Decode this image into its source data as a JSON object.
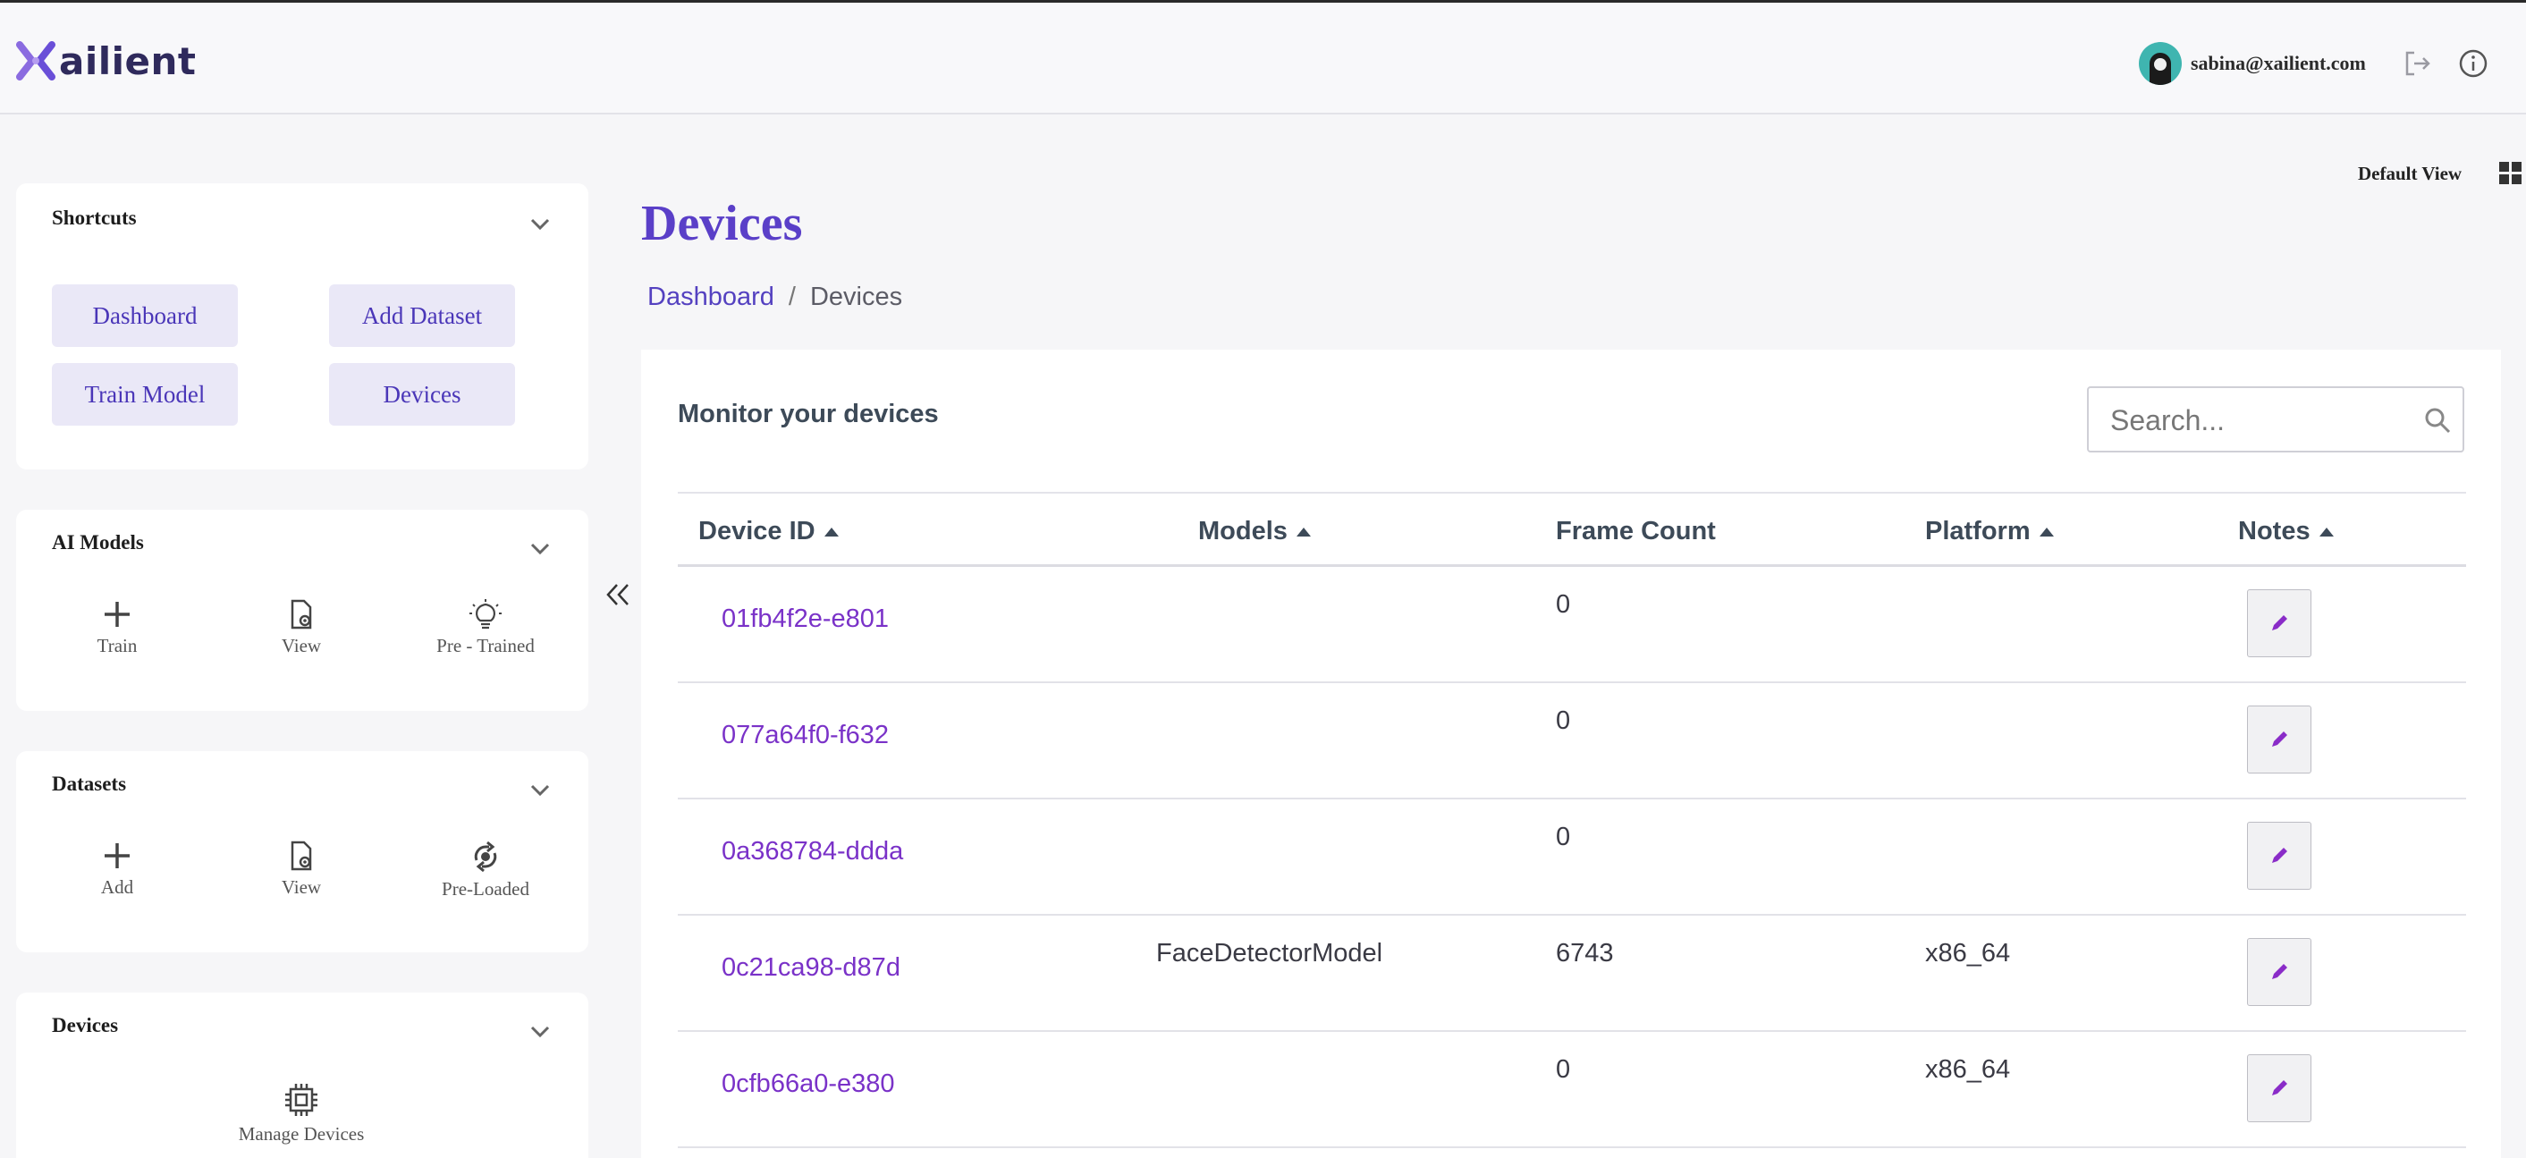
{
  "app": {
    "logo_text": "ailient",
    "user_email": "sabina@xailient.com"
  },
  "sidebar": {
    "shortcuts": {
      "title": "Shortcuts",
      "buttons": [
        "Dashboard",
        "Add Dataset",
        "Train Model",
        "Devices"
      ]
    },
    "ai_models": {
      "title": "AI Models",
      "tools": [
        {
          "label": "Train",
          "icon": "plus-icon"
        },
        {
          "label": "View",
          "icon": "file-view-icon"
        },
        {
          "label": "Pre - Trained",
          "icon": "lightbulb-icon"
        }
      ]
    },
    "datasets": {
      "title": "Datasets",
      "tools": [
        {
          "label": "Add",
          "icon": "plus-icon"
        },
        {
          "label": "View",
          "icon": "file-view-icon"
        },
        {
          "label": "Pre-Loaded",
          "icon": "refresh-icon"
        }
      ]
    },
    "devices": {
      "title": "Devices",
      "tools": [
        {
          "label": "Manage Devices",
          "icon": "chip-icon"
        }
      ]
    }
  },
  "main": {
    "view_label": "Default View",
    "title": "Devices",
    "breadcrumb": [
      "Dashboard",
      "Devices"
    ],
    "panel_title": "Monitor your devices",
    "search_placeholder": "Search...",
    "columns": [
      "Device ID",
      "Models",
      "Frame Count",
      "Platform",
      "Notes"
    ],
    "rows": [
      {
        "device_id": "01fb4f2e-e801",
        "models": "",
        "frame_count": "0",
        "platform": ""
      },
      {
        "device_id": "077a64f0-f632",
        "models": "",
        "frame_count": "0",
        "platform": ""
      },
      {
        "device_id": "0a368784-ddda",
        "models": "",
        "frame_count": "0",
        "platform": ""
      },
      {
        "device_id": "0c21ca98-d87d",
        "models": "FaceDetectorModel",
        "frame_count": "6743",
        "platform": "x86_64"
      },
      {
        "device_id": "0cfb66a0-e380",
        "models": "",
        "frame_count": "0",
        "platform": "x86_64"
      }
    ]
  },
  "colors": {
    "accent": "#5a3fc8",
    "link": "#7a32c8",
    "pill_bg": "#eae8f7"
  }
}
